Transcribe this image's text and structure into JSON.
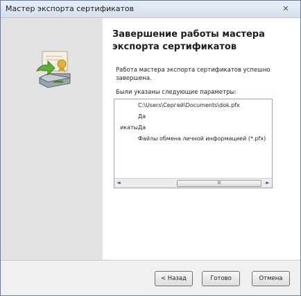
{
  "window": {
    "title": "Мастер экспорта сертификатов",
    "close_glyph": "✕"
  },
  "main": {
    "heading": "Завершение работы мастера экспорта сертификатов",
    "description": "Работа мастера экспорта сертификатов успешно завершена.",
    "params_label": "Были указаны следующие параметры:",
    "params": [
      {
        "name": "",
        "value": "C:\\Users\\Сергей\\Documents\\dok.pfx"
      },
      {
        "name": "",
        "value": "Да"
      },
      {
        "name": "икаты",
        "value": "Да"
      },
      {
        "name": "",
        "value": "Файлы обмена личной информацией (*.pfx)"
      }
    ],
    "scrollbar": {
      "left_arrow": "◄",
      "right_arrow": "►",
      "thumb_grip": "III"
    }
  },
  "buttons": {
    "back": "< Назад",
    "finish": "Готово",
    "cancel": "Отмена"
  },
  "icons": {
    "wizard": "certificate-export-icon"
  }
}
